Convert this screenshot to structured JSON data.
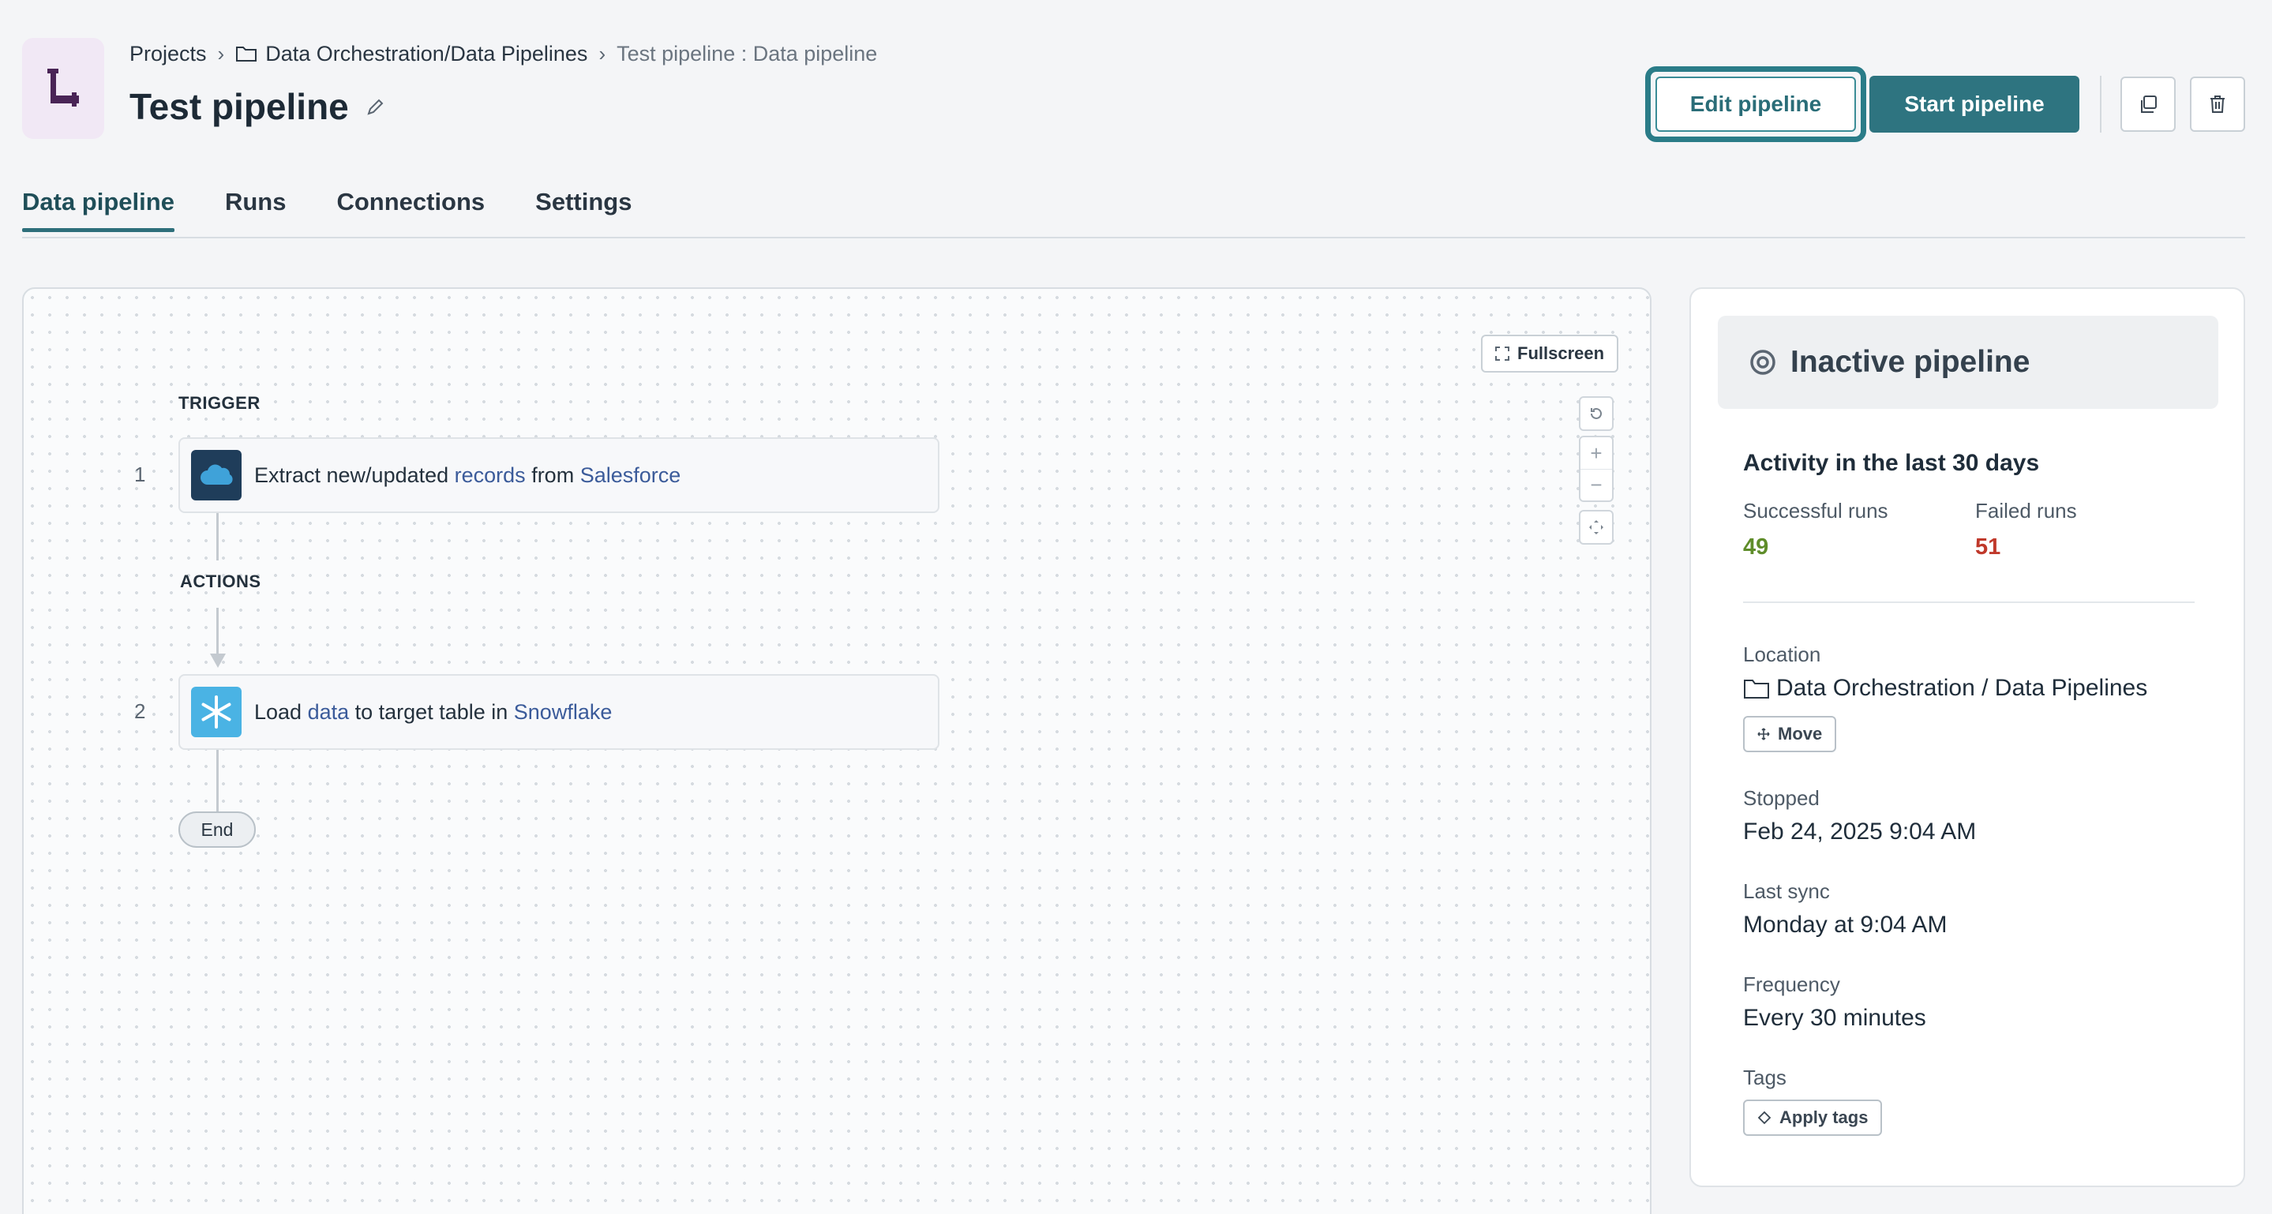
{
  "header": {
    "app_icon": "pipe-icon",
    "breadcrumb": {
      "root": "Projects",
      "folder": "Data Orchestration/Data Pipelines",
      "current": "Test pipeline : Data pipeline"
    },
    "title": "Test pipeline",
    "edit_pipeline_label": "Edit pipeline",
    "start_pipeline_label": "Start pipeline",
    "accent_color": "#2e7480"
  },
  "tabs": [
    {
      "label": "Data pipeline",
      "active": true
    },
    {
      "label": "Runs",
      "active": false
    },
    {
      "label": "Connections",
      "active": false
    },
    {
      "label": "Settings",
      "active": false
    }
  ],
  "canvas": {
    "fullscreen_label": "Fullscreen",
    "trigger_label": "TRIGGER",
    "actions_label": "ACTIONS",
    "end_label": "End",
    "steps": [
      {
        "number": "1",
        "app_icon": "salesforce-logo",
        "parts": [
          "Extract new/updated ",
          "records",
          " from ",
          "Salesforce"
        ]
      },
      {
        "number": "2",
        "app_icon": "snowflake-logo",
        "parts": [
          "Load ",
          "data",
          " to target table in ",
          "Snowflake"
        ]
      }
    ]
  },
  "panel": {
    "status": "Inactive pipeline",
    "activity_heading": "Activity in the last 30 days",
    "successful_label": "Successful runs",
    "successful_value": "49",
    "failed_label": "Failed runs",
    "failed_value": "51",
    "location_label": "Location",
    "location_value": "Data Orchestration / Data Pipelines",
    "move_label": "Move",
    "stopped_label": "Stopped",
    "stopped_value": "Feb 24, 2025 9:04 AM",
    "last_sync_label": "Last sync",
    "last_sync_value": "Monday at 9:04 AM",
    "frequency_label": "Frequency",
    "frequency_value": "Every 30 minutes",
    "tags_label": "Tags",
    "apply_tags_label": "Apply tags",
    "success_color": "#5f8d2a",
    "fail_color": "#c0392b"
  }
}
